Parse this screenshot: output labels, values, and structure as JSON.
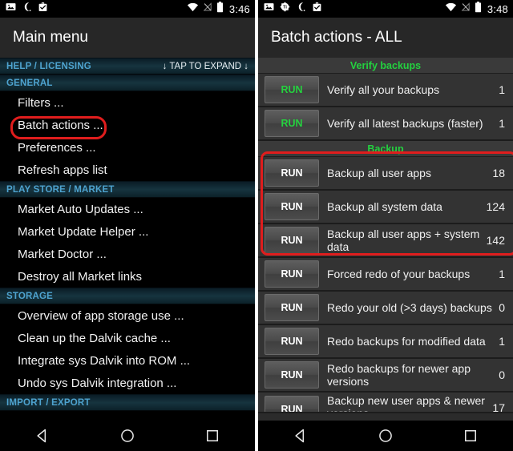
{
  "left": {
    "statusbar": {
      "icons": [
        "image-icon",
        "moon-icon",
        "briefcase-check-icon"
      ],
      "right_icons": [
        "wifi-icon",
        "signal-off-icon",
        "battery-icon"
      ],
      "time": "3:46"
    },
    "title": "Main menu",
    "sections": [
      {
        "name": "HELP / LICENSING",
        "hint": "↓ TAP TO EXPAND ↓",
        "items": []
      },
      {
        "name": "GENERAL",
        "hint": "",
        "items": [
          {
            "label": "Filters ...",
            "highlighted": false
          },
          {
            "label": "Batch actions ...",
            "highlighted": true
          },
          {
            "label": "Preferences ...",
            "highlighted": false
          },
          {
            "label": "Refresh apps list",
            "highlighted": false
          }
        ]
      },
      {
        "name": "PLAY STORE / MARKET",
        "hint": "",
        "items": [
          {
            "label": "Market Auto Updates ...",
            "highlighted": false
          },
          {
            "label": "Market Update Helper ...",
            "highlighted": false
          },
          {
            "label": "Market Doctor ...",
            "highlighted": false
          },
          {
            "label": "Destroy all Market links",
            "highlighted": false
          }
        ]
      },
      {
        "name": "STORAGE",
        "hint": "",
        "items": [
          {
            "label": "Overview of app storage use ...",
            "highlighted": false
          },
          {
            "label": "Clean up the Dalvik cache ...",
            "highlighted": false
          },
          {
            "label": "Integrate sys Dalvik into ROM ...",
            "highlighted": false
          },
          {
            "label": "Undo sys Dalvik integration ...",
            "highlighted": false
          }
        ]
      },
      {
        "name": "IMPORT / EXPORT",
        "hint": "",
        "items": []
      }
    ],
    "navbar": [
      "back-icon",
      "home-icon",
      "recents-icon"
    ]
  },
  "right": {
    "statusbar": {
      "icons": [
        "image-icon",
        "titanium-backup-icon",
        "moon-icon",
        "briefcase-check-icon"
      ],
      "right_icons": [
        "wifi-icon",
        "signal-off-icon",
        "battery-icon"
      ],
      "time": "3:48"
    },
    "title": "Batch actions - ALL",
    "categories": [
      {
        "name": "Verify backups",
        "rows": [
          {
            "run_label": "RUN",
            "run_green": true,
            "label": "Verify all your backups",
            "count": "1",
            "highlighted": false,
            "clipped": false
          },
          {
            "run_label": "RUN",
            "run_green": true,
            "label": "Verify all latest backups (faster)",
            "count": "1",
            "highlighted": false,
            "clipped": false
          }
        ]
      },
      {
        "name": "Backup",
        "rows": [
          {
            "run_label": "RUN",
            "run_green": false,
            "label": "Backup all user apps",
            "count": "18",
            "highlighted": true,
            "clipped": false
          },
          {
            "run_label": "RUN",
            "run_green": false,
            "label": "Backup all system data",
            "count": "124",
            "highlighted": true,
            "clipped": false
          },
          {
            "run_label": "RUN",
            "run_green": false,
            "label": "Backup all user apps + system data",
            "count": "142",
            "highlighted": true,
            "clipped": false
          },
          {
            "run_label": "RUN",
            "run_green": false,
            "label": "Forced redo of your backups",
            "count": "1",
            "highlighted": false,
            "clipped": false
          },
          {
            "run_label": "RUN",
            "run_green": false,
            "label": "Redo your old (>3 days) backups",
            "count": "0",
            "highlighted": false,
            "clipped": false
          },
          {
            "run_label": "RUN",
            "run_green": false,
            "label": "Redo backups for modified data",
            "count": "1",
            "highlighted": false,
            "clipped": false
          },
          {
            "run_label": "RUN",
            "run_green": false,
            "label": "Redo backups for newer app versions",
            "count": "0",
            "highlighted": false,
            "clipped": false
          },
          {
            "run_label": "RUN",
            "run_green": false,
            "label": "Backup new user apps & newer versions",
            "count": "17",
            "highlighted": false,
            "clipped": true
          }
        ]
      }
    ],
    "navbar": [
      "back-icon",
      "home-icon",
      "recents-icon"
    ]
  },
  "colors": {
    "highlight_red": "#e01d1d",
    "section_text_blue": "#4ea3cf",
    "category_green": "#23d13f",
    "row_bg": "#333333",
    "panel_bg": "#2b2b2b"
  }
}
